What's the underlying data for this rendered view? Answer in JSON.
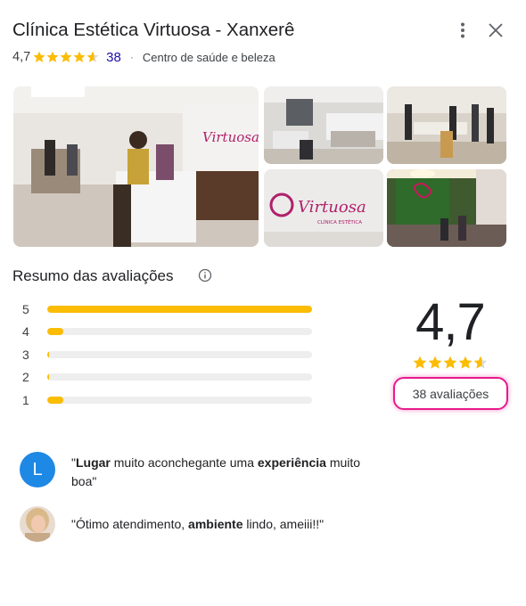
{
  "place": {
    "title": "Clínica Estética Virtuosa - Xanxerê",
    "rating": "4,7",
    "review_count": "38",
    "category": "Centro de saúde e beleza",
    "separator": "·"
  },
  "icons": {
    "more": "more-vert-icon",
    "close": "close-icon",
    "info": "info-icon"
  },
  "photos": [
    {
      "name": "reception",
      "sign_text": "Virtuosa"
    },
    {
      "name": "treatment-room"
    },
    {
      "name": "waiting-room"
    },
    {
      "name": "logo-wall",
      "sign_text": "Virtuosa",
      "sign_sub": "CLÍNICA ESTÉTICA"
    },
    {
      "name": "green-wall-lounge"
    }
  ],
  "summary": {
    "title": "Resumo das avaliações",
    "big_rating": "4,7",
    "stars_fraction": 0.94,
    "reviews_label": "38 avaliações",
    "distribution": [
      {
        "label": "5",
        "fill_fraction": 1.0
      },
      {
        "label": "4",
        "fill_fraction": 0.06
      },
      {
        "label": "3",
        "fill_fraction": 0.005
      },
      {
        "label": "2",
        "fill_fraction": 0.005
      },
      {
        "label": "1",
        "fill_fraction": 0.06
      }
    ]
  },
  "reviews": [
    {
      "avatar_letter": "L",
      "quote_open": "\"",
      "w1": "Lugar",
      "t1": " muito aconchegante uma ",
      "w2": "experiência",
      "t2": " muito boa",
      "quote_close": "\""
    },
    {
      "avatar_letter": "",
      "quote_open": "\"",
      "t0": "Ótimo atendimento, ",
      "w1": "ambiente",
      "t1": " lindo, ameiii!!",
      "quote_close": "\""
    }
  ],
  "colors": {
    "star": "#fbbc04",
    "star_empty": "#dadce0",
    "highlight": "#e8198b",
    "avatar": "#1e88e5",
    "link": "#1a0dab"
  }
}
